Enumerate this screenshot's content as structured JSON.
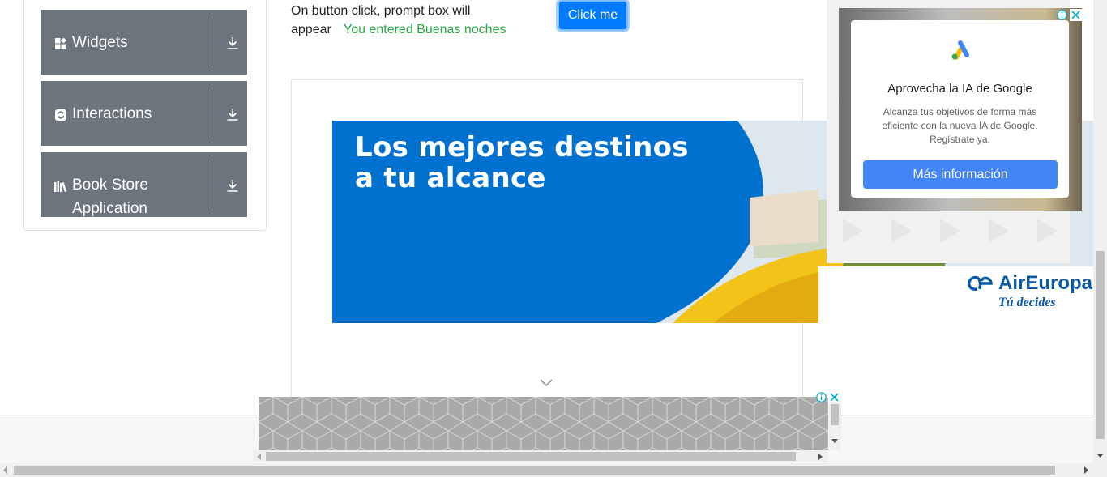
{
  "sidebar": {
    "groups": [
      {
        "label": "Widgets",
        "icon": "widgets-icon"
      },
      {
        "label": "Interactions",
        "icon": "interactions-icon"
      },
      {
        "label": "Book Store Application",
        "icon": "book-store-icon"
      }
    ]
  },
  "prompt_section": {
    "description": "On button click, prompt box will appear",
    "result": "You entered Buenas noches",
    "button_label": "Click me"
  },
  "banner_ad": {
    "headline_line1": "Los mejores destinos",
    "headline_line2": "a tu alcance",
    "brand": "AirEuropa",
    "tagline": "Tú decides",
    "colors": {
      "blue": "#0071ce",
      "brand": "#0a5aa8",
      "flowers": "#f2c318"
    }
  },
  "side_ad": {
    "title": "Aprovecha la IA de Google",
    "body": "Alcanza tus objetivos de forma más eficiente con la nueva IA de Google. Regístrate ya.",
    "cta": "Más información",
    "colors": {
      "cta": "#4285f4"
    }
  },
  "colors": {
    "sidebar_bg": "#6c757d",
    "primary": "#007bff",
    "success_text": "#28a745"
  }
}
